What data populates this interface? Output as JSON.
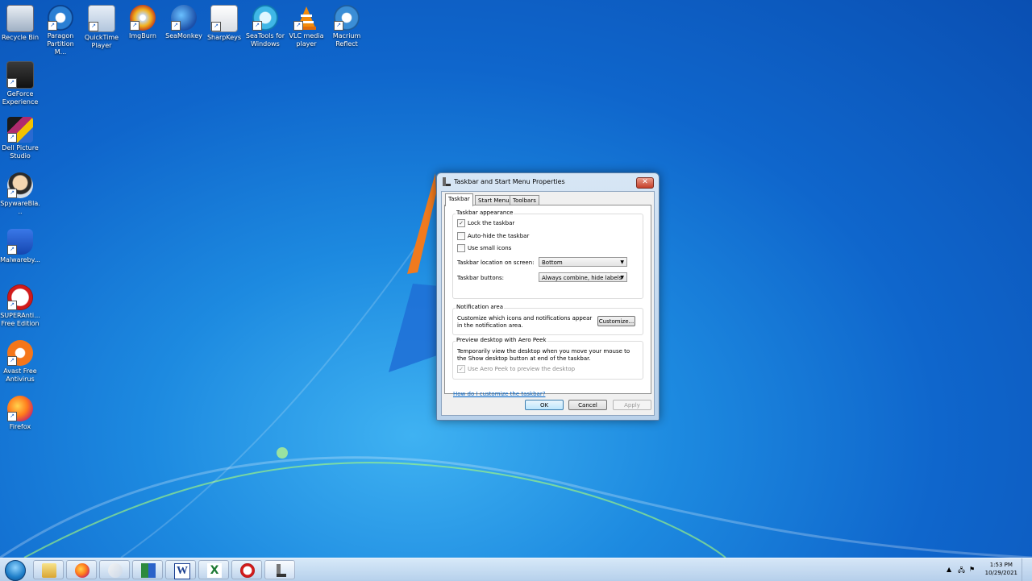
{
  "desktop": {
    "icons_top_row": [
      {
        "label": "Recycle Bin",
        "icon": "recycle-bin-icon"
      },
      {
        "label": "Paragon Partition M...",
        "icon": "paragon-icon"
      },
      {
        "label": "QuickTime Player",
        "icon": "quicktime-icon"
      },
      {
        "label": "ImgBurn",
        "icon": "imgburn-icon"
      },
      {
        "label": "SeaMonkey",
        "icon": "seamonkey-icon"
      },
      {
        "label": "SharpKeys",
        "icon": "sharpkeys-icon"
      },
      {
        "label": "SeaTools for Windows",
        "icon": "seatools-icon"
      },
      {
        "label": "VLC media player",
        "icon": "vlc-icon"
      },
      {
        "label": "Macrium Reflect",
        "icon": "macrium-icon"
      }
    ],
    "icons_left_col": [
      {
        "label": "GeForce Experience",
        "icon": "geforce-icon"
      },
      {
        "label": "Dell Picture Studio",
        "icon": "dell-picture-studio-icon"
      },
      {
        "label": "SpywareBla...",
        "icon": "spywareblaster-icon"
      },
      {
        "label": "Malwareby...",
        "icon": "malwarebytes-icon"
      },
      {
        "label": "SUPERAnti... Free Edition",
        "icon": "superantispyware-icon"
      },
      {
        "label": "Avast Free Antivirus",
        "icon": "avast-icon"
      },
      {
        "label": "Firefox",
        "icon": "firefox-icon"
      }
    ]
  },
  "dialog": {
    "title": "Taskbar and Start Menu Properties",
    "close_label": "✕",
    "tabs": [
      "Taskbar",
      "Start Menu",
      "Toolbars"
    ],
    "appearance": {
      "title": "Taskbar appearance",
      "lock": {
        "label": "Lock the taskbar",
        "checked": true
      },
      "autohide": {
        "label": "Auto-hide the taskbar",
        "checked": false
      },
      "small_icons": {
        "label": "Use small icons",
        "checked": false
      },
      "location_label": "Taskbar location on screen:",
      "location_value": "Bottom",
      "buttons_label": "Taskbar buttons:",
      "buttons_value": "Always combine, hide labels"
    },
    "notification": {
      "title": "Notification area",
      "desc": "Customize which icons and notifications appear in the notification area.",
      "customize_label": "Customize..."
    },
    "aero": {
      "title": "Preview desktop with Aero Peek",
      "desc": "Temporarily view the desktop when you move your mouse to the Show desktop button at end of the taskbar.",
      "checkbox_label": "Use Aero Peek to preview the desktop",
      "checked": true,
      "disabled": true
    },
    "help_link": "How do I customize the taskbar?",
    "ok_label": "OK",
    "cancel_label": "Cancel",
    "apply_label": "Apply"
  },
  "taskbar": {
    "pinned": [
      {
        "name": "explorer-icon"
      },
      {
        "name": "firefox-icon"
      },
      {
        "name": "paint-icon"
      },
      {
        "name": "network-app-icon"
      },
      {
        "name": "word-icon",
        "text": "W"
      },
      {
        "name": "excel-icon",
        "text": "X"
      },
      {
        "name": "superantispyware-icon"
      },
      {
        "name": "taskbar-properties-icon"
      }
    ],
    "clock_time": "1:53 PM",
    "clock_date": "10/29/2021"
  },
  "colors": {
    "desktop_blue": "#1d8ae0",
    "dialog_frame": "#b9d1ea",
    "link_blue": "#0066cc",
    "close_red": "#c6402a"
  }
}
